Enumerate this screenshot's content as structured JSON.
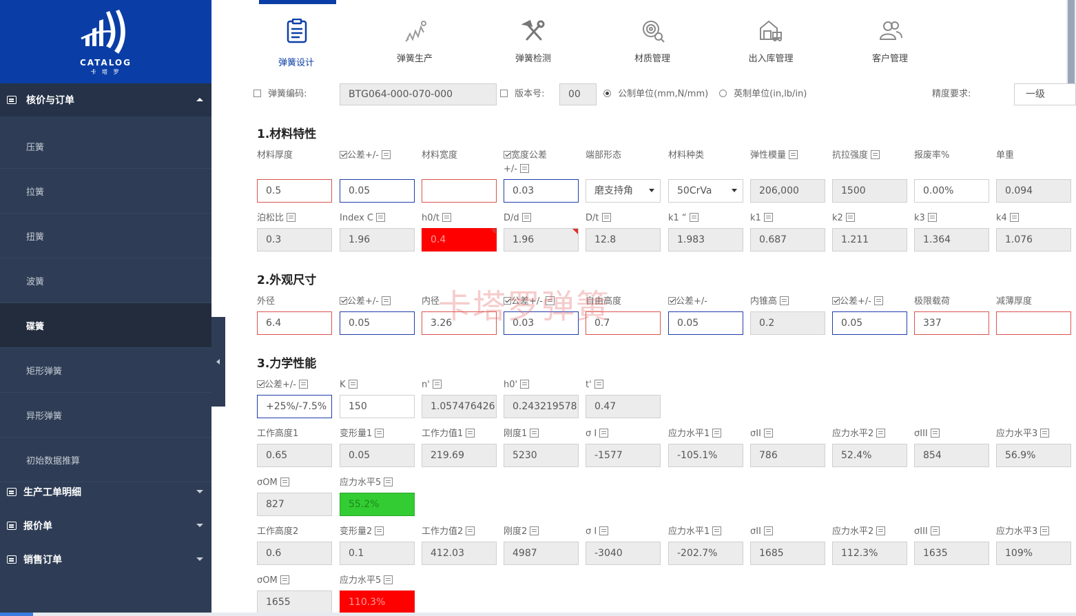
{
  "logo": {
    "brand": "CATALOG",
    "brand_sub": "卡 塔 罗"
  },
  "sidebar": {
    "section_title": "核价与订单",
    "items": [
      "压簧",
      "拉簧",
      "扭簧",
      "波簧",
      "碟簧",
      "矩形弹簧",
      "异形弹簧",
      "初始数据推算"
    ],
    "active": "碟簧",
    "groups": [
      "生产工单明细",
      "报价单",
      "销售订单"
    ]
  },
  "topnav": {
    "items": [
      {
        "label": "弹簧设计",
        "icon": "clipboard-icon"
      },
      {
        "label": "弹簧生产",
        "icon": "spring-icon"
      },
      {
        "label": "弹簧检测",
        "icon": "tools-icon"
      },
      {
        "label": "材质管理",
        "icon": "magnifier-icon"
      },
      {
        "label": "出入库管理",
        "icon": "warehouse-truck-icon"
      },
      {
        "label": "客户管理",
        "icon": "users-icon"
      }
    ]
  },
  "header": {
    "code_label": "弹簧编码:",
    "code_value": "BTG064-000-070-000",
    "version_label": "版本号:",
    "version_value": "00",
    "unit_metric": "公制单位(mm,N/mm)",
    "unit_imperial": "英制单位(in,lb/in)",
    "precision_label": "精度要求:",
    "precision_value": "一级"
  },
  "sections": {
    "s1": "1.材料特性",
    "s2": "2.外观尺寸",
    "s3": "3.力学性能"
  },
  "watermark": "卡塔罗弹簧",
  "s1_row1": {
    "labels": [
      "材料厚度",
      "公差+/-",
      "材料宽度",
      "宽度公差",
      "端部形态",
      "材料种类",
      "弹性模量",
      "抗拉强度",
      "报废率%",
      "单重"
    ],
    "label_suffix_4": "+/-",
    "values": [
      "0.5",
      "0.05",
      "",
      "0.03",
      "磨支持角",
      "50CrVa",
      "206,000",
      "1500",
      "0.00%",
      "0.094"
    ]
  },
  "s1_row2": {
    "labels": [
      "泊松比",
      "Index C",
      "h0/t",
      "D/d",
      "D/t",
      "k1 “",
      "k1",
      "k2",
      "k3",
      "k4"
    ],
    "values": [
      "0.3",
      "1.96",
      "0.4",
      "1.96",
      "12.8",
      "1.983",
      "0.687",
      "1.211",
      "1.364",
      "1.076"
    ]
  },
  "s2_row1": {
    "labels": [
      "外径",
      "公差+/-",
      "内径",
      "公差+/-",
      "自由高度",
      "公差+/-",
      "内锥高",
      "公差+/-",
      "极限载荷",
      "减薄厚度"
    ],
    "values": [
      "6.4",
      "0.05",
      "3.26",
      "0.03",
      "0.7",
      "0.05",
      "0.2",
      "0.05",
      "337",
      ""
    ]
  },
  "s3_row1": {
    "labels": [
      "公差+/-",
      "K",
      "n'",
      "h0'",
      "t'"
    ],
    "values": [
      "+25%/-7.5%",
      "150",
      "1.057476426",
      "0.243219578",
      "0.47"
    ]
  },
  "s3_row2": {
    "labels": [
      "工作高度1",
      "变形量1",
      "工作力值1",
      "刚度1",
      "σ I",
      "应力水平1",
      "σII",
      "应力水平2",
      "σIII",
      "应力水平3"
    ],
    "values": [
      "0.65",
      "0.05",
      "219.69",
      "5230",
      "-1577",
      "-105.1%",
      "786",
      "52.4%",
      "854",
      "56.9%"
    ]
  },
  "s3_row3": {
    "labels": [
      "σOM",
      "应力水平5"
    ],
    "values": [
      "827",
      "55.2%"
    ]
  },
  "s3_row4": {
    "labels": [
      "工作高度2",
      "变形量2",
      "工作力值2",
      "刚度2",
      "σ I",
      "应力水平1",
      "σII",
      "应力水平2",
      "σIII",
      "应力水平3"
    ],
    "values": [
      "0.6",
      "0.1",
      "412.03",
      "4987",
      "-3040",
      "-202.7%",
      "1685",
      "112.3%",
      "1635",
      "109%"
    ]
  },
  "s3_row5": {
    "labels": [
      "σOM",
      "应力水平5"
    ],
    "values": [
      "1655",
      "110.3%"
    ]
  },
  "colors": {
    "brand": "#0a3ea6",
    "sidebar": "#2e3d55",
    "alert": "#ff0000",
    "ok": "#33cc33"
  }
}
